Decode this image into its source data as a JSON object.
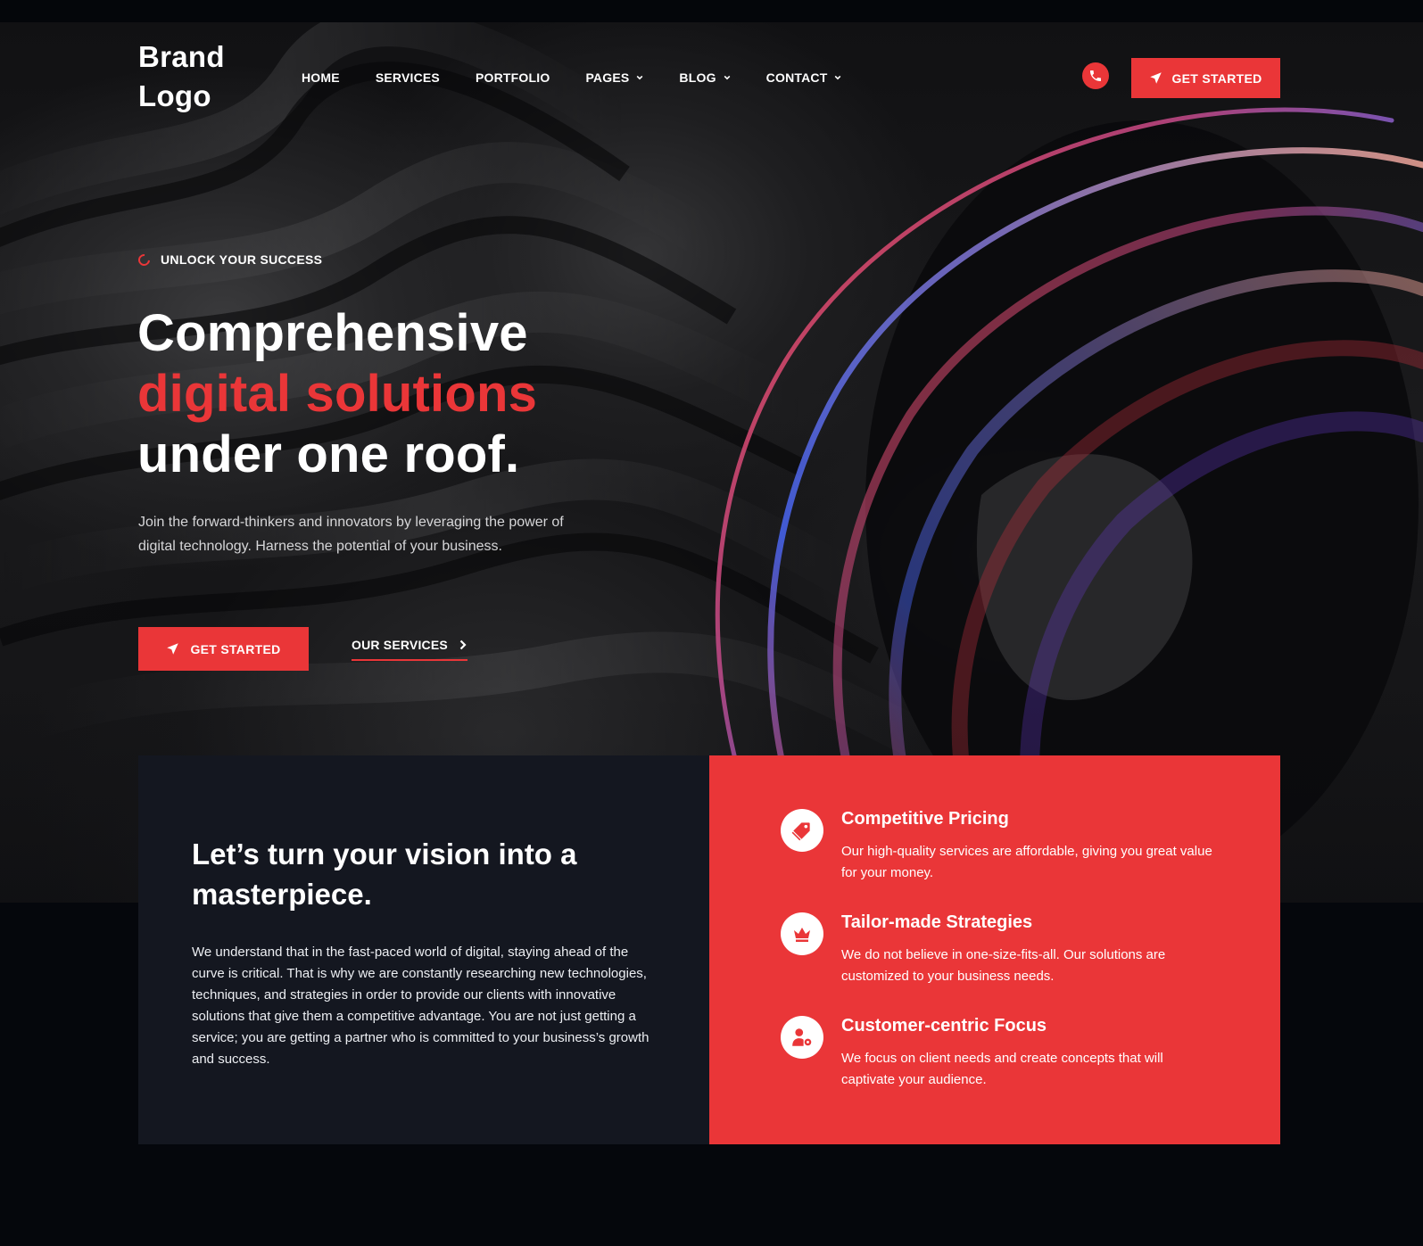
{
  "header": {
    "brand": "Brand Logo",
    "nav": [
      {
        "label": "HOME",
        "dropdown": false
      },
      {
        "label": "SERVICES",
        "dropdown": false
      },
      {
        "label": "PORTFOLIO",
        "dropdown": false
      },
      {
        "label": "PAGES",
        "dropdown": true
      },
      {
        "label": "BLOG",
        "dropdown": true
      },
      {
        "label": "CONTACT",
        "dropdown": true
      }
    ],
    "phone_icon": "phone-icon",
    "cta_label": "GET STARTED",
    "cta_icon": "paper-plane-icon"
  },
  "hero": {
    "eyebrow": "UNLOCK YOUR SUCCESS",
    "headline_line1": "Comprehensive",
    "headline_line2": "digital solutions",
    "headline_line3": "under one roof.",
    "description": "Join the forward-thinkers and innovators by leveraging the power of digital technology. Harness the potential of your business.",
    "primary_cta": "GET STARTED",
    "secondary_cta": "OUR SERVICES"
  },
  "intro": {
    "title": "Let’s turn your vision into a masterpiece.",
    "body": "We understand that in the fast-paced world of digital, staying ahead of the curve is critical. That is why we are constantly researching new technologies, techniques, and strategies in order to provide our clients with innovative solutions that give them a competitive advantage. You are not just getting a service; you are getting a partner who is committed to your business’s growth and success."
  },
  "features": [
    {
      "icon": "price-tag-icon",
      "title": "Competitive Pricing",
      "desc": "Our high-quality services are affordable, giving you great value for your money."
    },
    {
      "icon": "crown-icon",
      "title": "Tailor-made Strategies",
      "desc": "We do not believe in one-size-fits-all. Our solutions are customized to your business needs."
    },
    {
      "icon": "user-gear-icon",
      "title": "Customer-centric Focus",
      "desc": "We focus on client needs and create concepts that will captivate your audience."
    }
  ],
  "colors": {
    "accent": "#ea3638",
    "dark_card": "#141720",
    "page_bg": "#05070c"
  }
}
